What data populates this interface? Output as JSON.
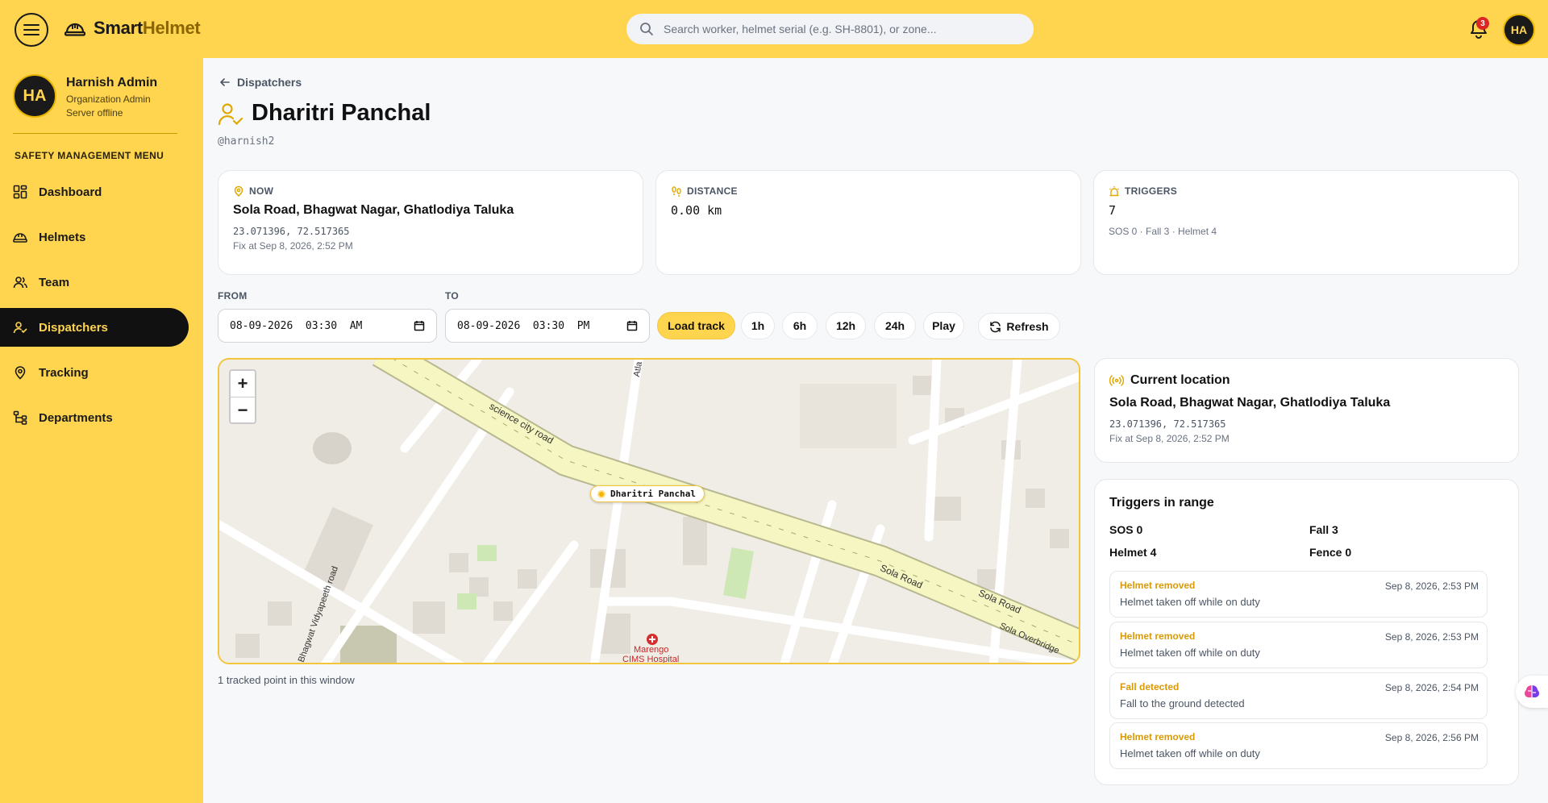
{
  "brand": {
    "part1": "Smart",
    "part2": "Helmet"
  },
  "search": {
    "placeholder": "Search worker, helmet serial (e.g. SH-8801), or zone..."
  },
  "notifications": {
    "count": "3"
  },
  "user": {
    "initials": "HA",
    "name": "Harnish Admin",
    "role": "Organization Admin",
    "status": "Server offline"
  },
  "sidebar": {
    "menu_title": "SAFETY MANAGEMENT MENU",
    "items": [
      {
        "label": "Dashboard",
        "icon": "dashboard-icon"
      },
      {
        "label": "Helmets",
        "icon": "helmet-icon"
      },
      {
        "label": "Team",
        "icon": "team-icon"
      },
      {
        "label": "Dispatchers",
        "icon": "dispatcher-icon",
        "active": true
      },
      {
        "label": "Tracking",
        "icon": "location-pin-icon"
      },
      {
        "label": "Departments",
        "icon": "departments-icon"
      }
    ]
  },
  "breadcrumb": {
    "label": "Dispatchers"
  },
  "page": {
    "title": "Dharitri Panchal",
    "username": "@harnish2"
  },
  "stats": {
    "now": {
      "label": "NOW",
      "value": "Sola Road, Bhagwat Nagar, Ghatlodiya Taluka",
      "coords": "23.071396, 72.517365",
      "fix": "Fix at Sep 8, 2026, 2:52 PM"
    },
    "distance": {
      "label": "DISTANCE",
      "value": "0.00 km"
    },
    "triggers": {
      "label": "TRIGGERS",
      "value": "7",
      "breakdown": "SOS 0 · Fall 3 · Helmet 4"
    }
  },
  "range": {
    "from_label": "FROM",
    "from_value": "08-09-2026  03:30  AM",
    "to_label": "TO",
    "to_value": "08-09-2026  03:30  PM",
    "buttons": {
      "load": "Load track",
      "h1": "1h",
      "h6": "6h",
      "h12": "12h",
      "h24": "24h",
      "play": "Play",
      "refresh": "Refresh"
    }
  },
  "map": {
    "marker_label": "Dharitri Panchal",
    "zoom_in": "+",
    "zoom_out": "−",
    "labels": {
      "road1": "science city road",
      "road2": "Sola Road",
      "road3": "Sola Road",
      "road4": "Sola Overbridge",
      "road5": "Bhagwat Vidyapeeth road",
      "road6": "Atla",
      "hospital1": "Marengo",
      "hospital2": "CIMS Hospital"
    },
    "note": "1 tracked point in this window"
  },
  "current_location": {
    "title": "Current location",
    "address": "Sola Road, Bhagwat Nagar, Ghatlodiya Taluka",
    "coords": "23.071396, 72.517365",
    "fix": "Fix at Sep 8, 2026, 2:52 PM"
  },
  "triggers_range": {
    "title": "Triggers in range",
    "sos": "SOS 0",
    "fall": "Fall 3",
    "helmet": "Helmet 4",
    "fence": "Fence 0",
    "events": [
      {
        "title": "Helmet removed",
        "time": "Sep 8, 2026, 2:53 PM",
        "desc": "Helmet taken off while on duty"
      },
      {
        "title": "Helmet removed",
        "time": "Sep 8, 2026, 2:53 PM",
        "desc": "Helmet taken off while on duty"
      },
      {
        "title": "Fall detected",
        "time": "Sep 8, 2026, 2:54 PM",
        "desc": "Fall to the ground detected"
      },
      {
        "title": "Helmet removed",
        "time": "Sep 8, 2026, 2:56 PM",
        "desc": "Helmet taken off while on duty"
      }
    ]
  },
  "colors": {
    "accent": "#ffd54f",
    "dark": "#111111",
    "warning_text": "#d99a06"
  }
}
